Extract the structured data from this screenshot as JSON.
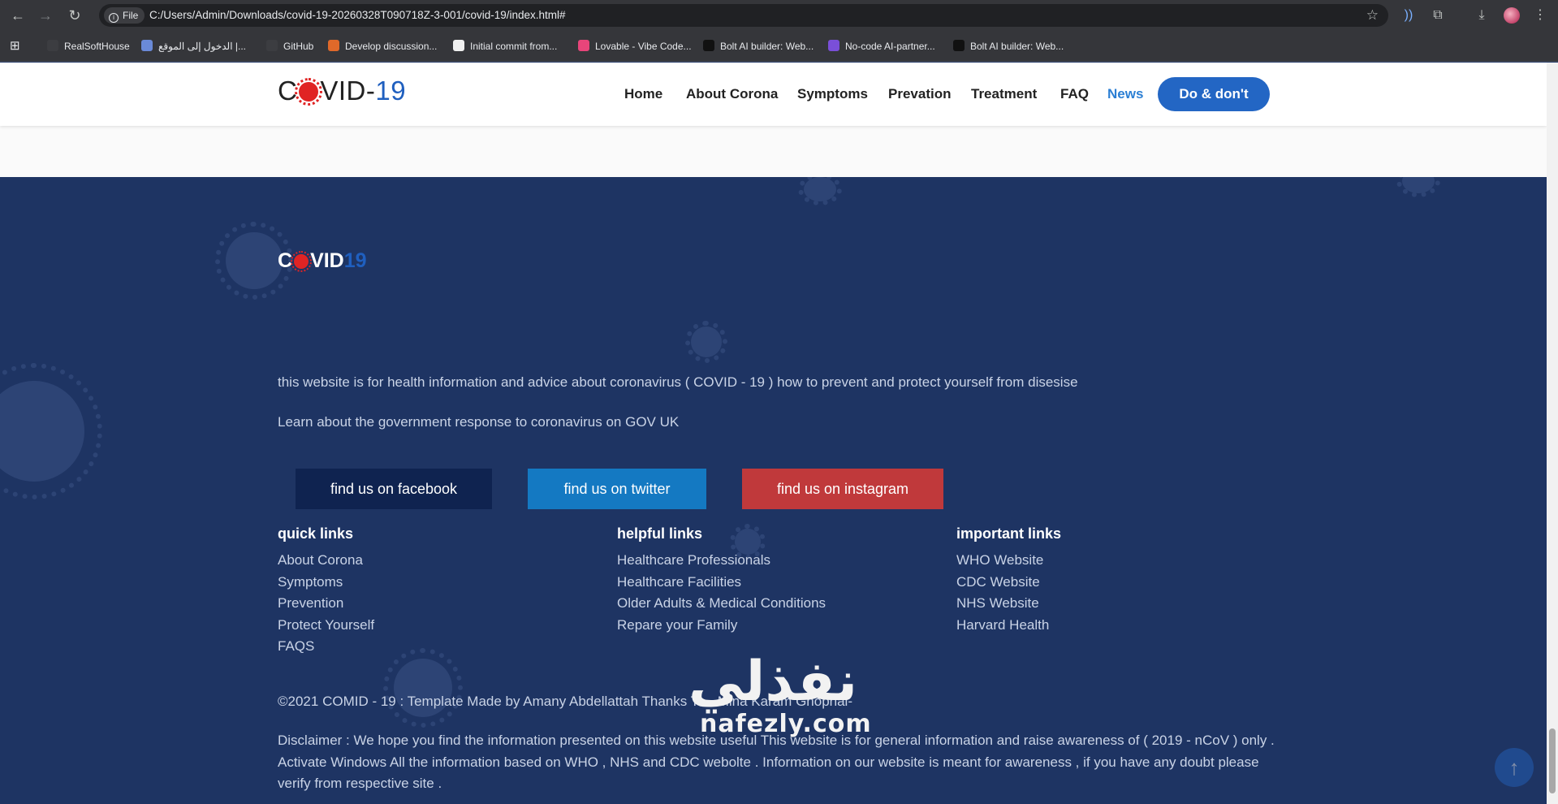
{
  "browser": {
    "site_chip": "File",
    "url": "C:/Users/Admin/Downloads/covid-19-20260328T090718Z-3-001/covid-19/index.html#",
    "bookmarks": [
      {
        "label": "RealSoftHouse",
        "color": "#3c3d41"
      },
      {
        "label": "الدخول إلى الموقع |...",
        "color": "#6a8ad8"
      },
      {
        "label": "GitHub",
        "color": "#3c3d41"
      },
      {
        "label": "Develop discussion...",
        "color": "#e0692a"
      },
      {
        "label": "Initial commit from...",
        "color": "#f0f0f0"
      },
      {
        "label": "Lovable - Vibe Code...",
        "color": "#e8457a"
      },
      {
        "label": "Bolt AI builder: Web...",
        "color": "#111111"
      },
      {
        "label": "No-code AI-partner...",
        "color": "#7a4fd8"
      },
      {
        "label": "Bolt AI builder: Web...",
        "color": "#111111"
      }
    ]
  },
  "header": {
    "logo_pre": "C",
    "logo_post": "VID-",
    "logo_num": "19",
    "nav": [
      "Home",
      "About Corona",
      "Symptoms",
      "Prevation",
      "Treatment",
      "FAQ",
      "News"
    ],
    "active_nav": "News",
    "cta": "Do & don't"
  },
  "footer": {
    "logo_pre": "C",
    "logo_post": "VID",
    "logo_num": "19",
    "about": "this website is for health information and advice about coronavirus ( COVID - 19 ) how to prevent and protect yourself from disesise",
    "gov": "Learn about the government response to coronavirus on GOV UK",
    "social": [
      {
        "label": "find us on facebook",
        "color": "#0f2350"
      },
      {
        "label": "find us on twitter",
        "color": "#1479c2"
      },
      {
        "label": "find us on instagram",
        "color": "#c0393b"
      }
    ],
    "columns": [
      {
        "title": "quick links",
        "items": [
          "About Corona",
          "Symptoms",
          "Prevention",
          "Protect Yourself",
          "FAQS"
        ]
      },
      {
        "title": "helpful links",
        "items": [
          "Healthcare Professionals",
          "Healthcare Facilities",
          "Older Adults & Medical Conditions",
          "Repare your Family"
        ]
      },
      {
        "title": "important links",
        "items": [
          "WHO Website",
          "CDC Website",
          "NHS Website",
          "Harvard Health"
        ]
      }
    ],
    "copyright": "©2021 COMID - 19 : Template Made by Amany Abdellattah Thanks To - Mina Karam Ghoprial-",
    "disclaimer": "Disclaimer : We hope you find the information presented on this website useful This website is for general information and raise awareness of ( 2019 - nCoV ) only . Activate Windows All the information based on WHO , NHS and CDC webolte . Information on our website is meant for awareness , if you have any doubt please verify from respective site ."
  },
  "watermark": {
    "arabic": "نفذلي",
    "latin": "nafezly.com"
  },
  "colors": {
    "footer_bg": "#1e3463",
    "accent": "#2366c4",
    "active_link": "#2b7fd4",
    "virus_red": "#e02424"
  }
}
